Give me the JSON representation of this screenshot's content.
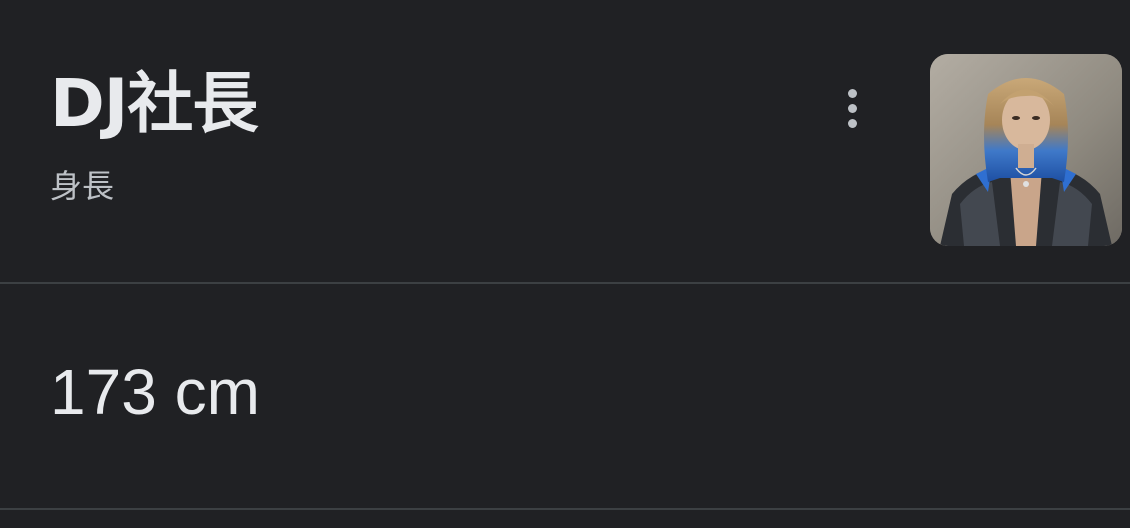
{
  "entity": {
    "name": "DJ社長",
    "attribute_label": "身長"
  },
  "answer": {
    "value": "173 cm"
  },
  "menu": {
    "icon": "more-vert-icon"
  },
  "thumbnail": {
    "icon": "person-photo"
  },
  "colors": {
    "background": "#202124",
    "primary_text": "#e8eaed",
    "secondary_text": "#bdc1c6",
    "divider": "#3c4043",
    "hair_blue": "#2f6fd1"
  }
}
